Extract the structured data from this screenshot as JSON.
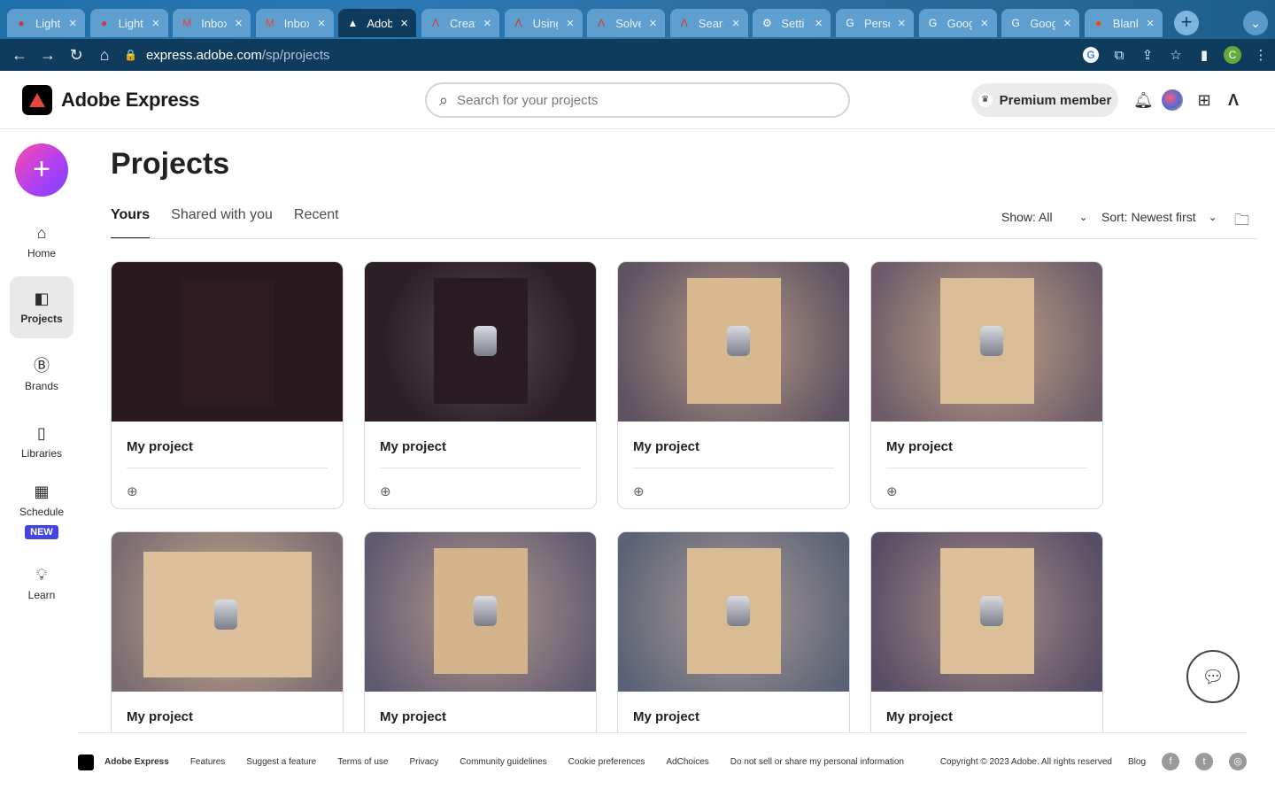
{
  "browser": {
    "tabs": [
      {
        "label": "Light",
        "icon": "drop-icon",
        "favicon_color": "#c9394a"
      },
      {
        "label": "Light",
        "icon": "drop-icon",
        "favicon_color": "#c9394a"
      },
      {
        "label": "Inbox",
        "icon": "gmail-icon",
        "favicon_color": "#ea4335"
      },
      {
        "label": "Inbox",
        "icon": "gmail-icon",
        "favicon_color": "#ea4335"
      },
      {
        "label": "Adob",
        "icon": "adobe-express-icon",
        "favicon_color": "#ffffff"
      },
      {
        "label": "Creat",
        "icon": "adobe-icon",
        "favicon_color": "#e0341d"
      },
      {
        "label": "Using",
        "icon": "adobe-icon",
        "favicon_color": "#e0341d"
      },
      {
        "label": "Solve",
        "icon": "adobe-icon",
        "favicon_color": "#e0341d"
      },
      {
        "label": "Searc",
        "icon": "adobe-icon",
        "favicon_color": "#e0341d"
      },
      {
        "label": "Setti",
        "icon": "gear-icon",
        "favicon_color": "#ffffff"
      },
      {
        "label": "Perso",
        "icon": "google-icon",
        "favicon_color": "#ffffff"
      },
      {
        "label": "Goog",
        "icon": "google-icon",
        "favicon_color": "#ffffff"
      },
      {
        "label": "Goog",
        "icon": "google-icon",
        "favicon_color": "#ffffff"
      },
      {
        "label": "Blank",
        "icon": "reddit-icon",
        "favicon_color": "#ff4500"
      }
    ],
    "active_tab_index": 4,
    "url_host": "express.adobe.com",
    "url_path": "/sp/projects",
    "profile_initial": "C"
  },
  "app": {
    "brand": "Adobe Express",
    "search_placeholder": "Search for your projects",
    "premium_label": "Premium member"
  },
  "nav": {
    "create_label": "+",
    "items": [
      {
        "label": "Home",
        "icon": "home-icon"
      },
      {
        "label": "Projects",
        "icon": "projects-icon",
        "active": true
      },
      {
        "label": "Brands",
        "icon": "brands-icon"
      },
      {
        "label": "Libraries",
        "icon": "libraries-icon"
      },
      {
        "label": "Schedule",
        "icon": "calendar-icon",
        "badge": "NEW"
      },
      {
        "label": "Learn",
        "icon": "lightbulb-icon"
      }
    ]
  },
  "main": {
    "title": "Projects",
    "tabs": [
      {
        "label": "Yours",
        "active": true
      },
      {
        "label": "Shared with you"
      },
      {
        "label": "Recent"
      }
    ],
    "show_filter": "Show: All",
    "sort_filter": "Sort: Newest first",
    "projects": [
      {
        "name": "My project"
      },
      {
        "name": "My project"
      },
      {
        "name": "My project"
      },
      {
        "name": "My project"
      },
      {
        "name": "My project"
      },
      {
        "name": "My project"
      },
      {
        "name": "My project"
      },
      {
        "name": "My project"
      }
    ]
  },
  "footer": {
    "brand": "Adobe Express",
    "links": [
      "Features",
      "Suggest a feature",
      "Terms of use",
      "Privacy",
      "Community guidelines",
      "Cookie preferences",
      "AdChoices",
      "Do not sell or share my personal information"
    ],
    "copyright": "Copyright © 2023 Adobe. All rights reserved",
    "blog": "Blog"
  }
}
